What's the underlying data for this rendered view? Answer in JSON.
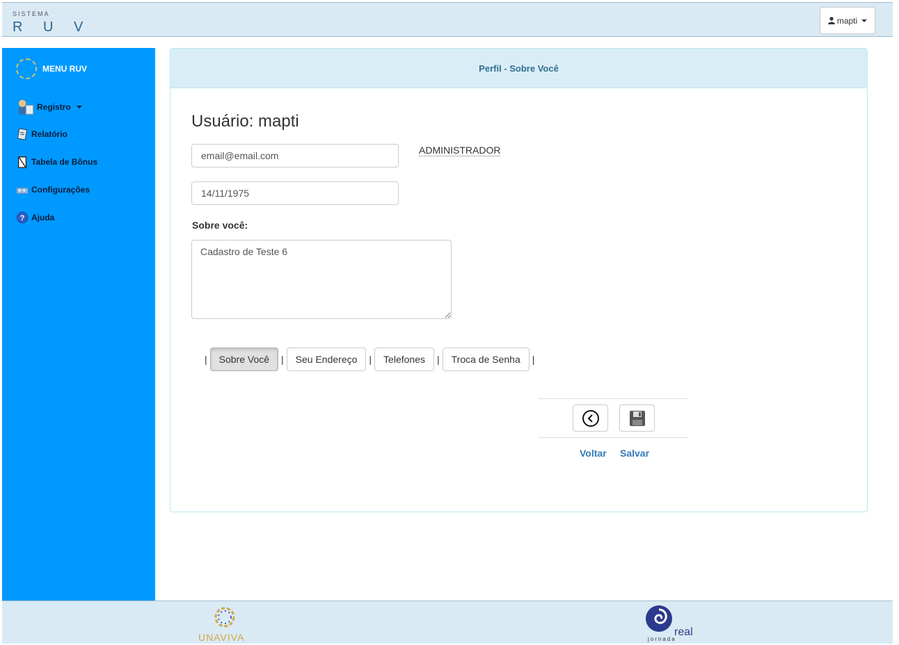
{
  "header": {
    "system_label": "SISTEMA",
    "system_name": "R U V",
    "user_menu_label": "mapti"
  },
  "sidebar": {
    "title": "MENU RUV",
    "items": [
      {
        "label": "Registro",
        "icon": "register-icon",
        "has_dropdown": true
      },
      {
        "label": "Relatório",
        "icon": "report-icon"
      },
      {
        "label": "Tabela de Bônus",
        "icon": "bonus-table-icon"
      },
      {
        "label": "Configurações",
        "icon": "settings-icon"
      },
      {
        "label": "Ajuda",
        "icon": "help-icon"
      }
    ]
  },
  "panel": {
    "title": "Perfil - Sobre Você",
    "user_heading": "Usuário: mapti",
    "email_value": "email@email.com",
    "role": "ADMINISTRADOR",
    "birthdate_value": "14/11/1975",
    "about_label": "Sobre você:",
    "about_value": "Cadastro de Teste 6",
    "tabs": [
      {
        "label": "Sobre Você",
        "active": true
      },
      {
        "label": "Seu Endereço",
        "active": false
      },
      {
        "label": "Telefones",
        "active": false
      },
      {
        "label": "Troca de Senha",
        "active": false
      }
    ],
    "tab_separator": "|",
    "actions": {
      "back_label": "Voltar",
      "save_label": "Salvar"
    }
  },
  "footer": {
    "left_logo_text": "UNAVIVA",
    "right_logo_text": "real",
    "right_logo_subtext": "jornada"
  },
  "colors": {
    "sidebar_bg": "#0099ff",
    "header_bg": "#d9eaf4",
    "panel_heading_bg": "#d9edf7",
    "link_blue": "#337ab7"
  }
}
